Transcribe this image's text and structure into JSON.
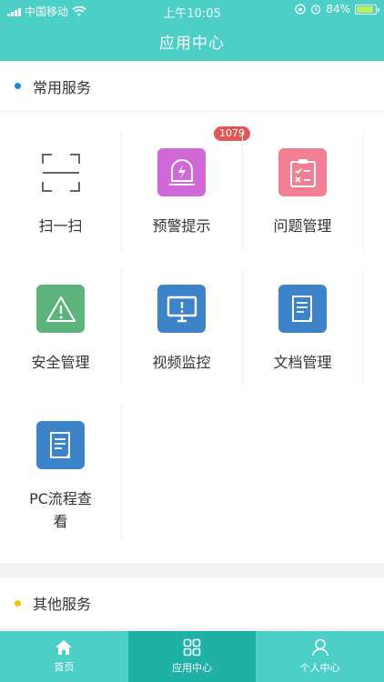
{
  "status": {
    "carrier": "中国移动",
    "time": "上午10:05",
    "battery": "84%",
    "battery_level": 0.84
  },
  "header": {
    "title": "应用中心"
  },
  "common_services": {
    "title": "常用服务",
    "dot_color": "#1e88e5",
    "items": [
      {
        "label": "扫一扫",
        "icon": "scan-icon"
      },
      {
        "label": "预警提示",
        "icon": "warning-light-icon",
        "badge": "1079",
        "color": "#d168d8"
      },
      {
        "label": "问题管理",
        "icon": "clipboard-icon",
        "color": "#f27f93"
      },
      {
        "label": "安全管理",
        "icon": "alert-triangle-icon",
        "color": "#5cb37c"
      },
      {
        "label": "视频监控",
        "icon": "monitor-icon",
        "color": "#3d83c9"
      },
      {
        "label": "文档管理",
        "icon": "document-icon",
        "color": "#3d83c9"
      },
      {
        "label": "PC流程查看",
        "icon": "document-icon",
        "color": "#3d83c9"
      }
    ]
  },
  "other_services": {
    "title": "其他服务",
    "dot_color": "#f2c200"
  },
  "tabbar": {
    "tabs": [
      {
        "label": "首页",
        "icon": "home-icon"
      },
      {
        "label": "应用中心",
        "icon": "grid-icon",
        "active": true
      },
      {
        "label": "个人中心",
        "icon": "user-icon"
      }
    ]
  }
}
